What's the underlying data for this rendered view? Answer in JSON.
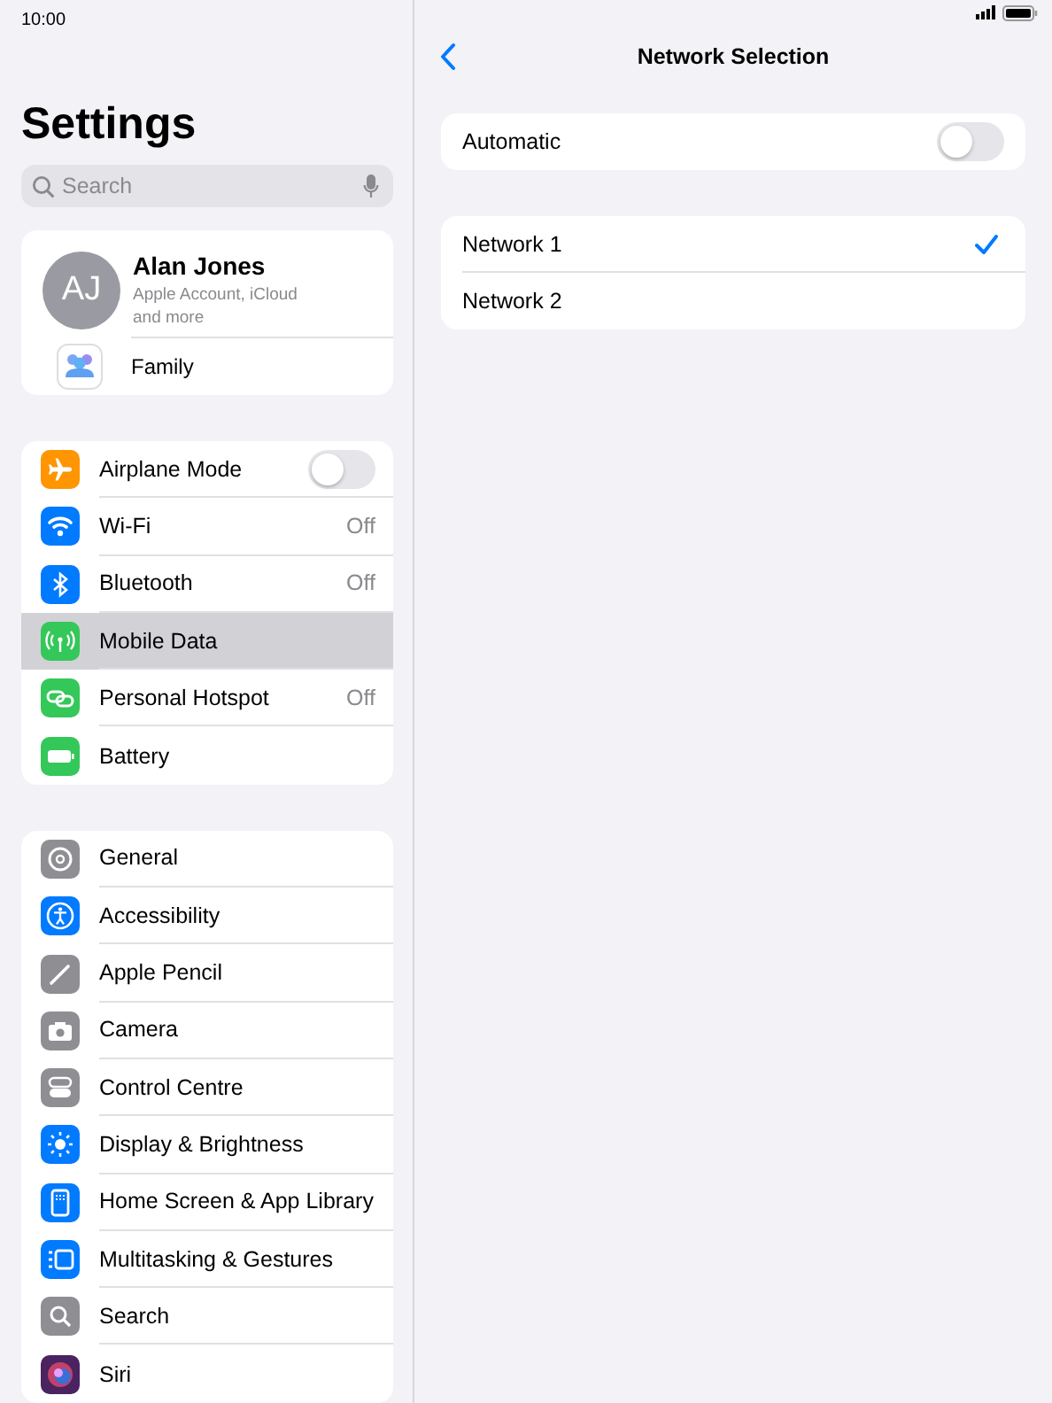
{
  "status_bar": {
    "time": "10:00"
  },
  "sidebar": {
    "title": "Settings",
    "search": {
      "placeholder": "Search"
    },
    "account": {
      "initials": "AJ",
      "name": "Alan Jones",
      "subtitle": "Apple Account, iCloud and more",
      "family": "Family"
    },
    "groups": [
      {
        "items": [
          {
            "label": "Airplane Mode",
            "color": "#ff9500",
            "kind": "toggle",
            "on": false,
            "selected": false
          },
          {
            "label": "Wi-Fi",
            "color": "#007aff",
            "kind": "value",
            "value": "Off",
            "selected": false
          },
          {
            "label": "Bluetooth",
            "color": "#007aff",
            "kind": "value",
            "value": "Off",
            "selected": false
          },
          {
            "label": "Mobile Data",
            "color": "#34c759",
            "kind": "plain",
            "selected": true
          },
          {
            "label": "Personal Hotspot",
            "color": "#34c759",
            "kind": "value",
            "value": "Off",
            "selected": false
          },
          {
            "label": "Battery",
            "color": "#34c759",
            "kind": "plain",
            "selected": false
          }
        ]
      },
      {
        "items": [
          {
            "label": "General",
            "color": "#8e8e93",
            "kind": "plain",
            "selected": false
          },
          {
            "label": "Accessibility",
            "color": "#007aff",
            "kind": "plain",
            "selected": false
          },
          {
            "label": "Apple Pencil",
            "color": "#8e8e93",
            "kind": "plain",
            "selected": false
          },
          {
            "label": "Camera",
            "color": "#8e8e93",
            "kind": "plain",
            "selected": false
          },
          {
            "label": "Control Centre",
            "color": "#8e8e93",
            "kind": "plain",
            "selected": false
          },
          {
            "label": "Display & Brightness",
            "color": "#007aff",
            "kind": "plain",
            "selected": false
          },
          {
            "label": "Home Screen & App Library",
            "color": "#007aff",
            "kind": "plain",
            "selected": false
          },
          {
            "label": "Multitasking & Gestures",
            "color": "#007aff",
            "kind": "plain",
            "selected": false
          },
          {
            "label": "Search",
            "color": "#8e8e93",
            "kind": "plain",
            "selected": false
          },
          {
            "label": "Siri",
            "color": "#4a2360",
            "kind": "plain",
            "selected": false
          }
        ]
      }
    ]
  },
  "detail": {
    "title": "Network Selection",
    "automatic": {
      "label": "Automatic",
      "on": false
    },
    "networks": [
      {
        "label": "Network 1",
        "selected": true
      },
      {
        "label": "Network 2",
        "selected": false
      }
    ]
  }
}
